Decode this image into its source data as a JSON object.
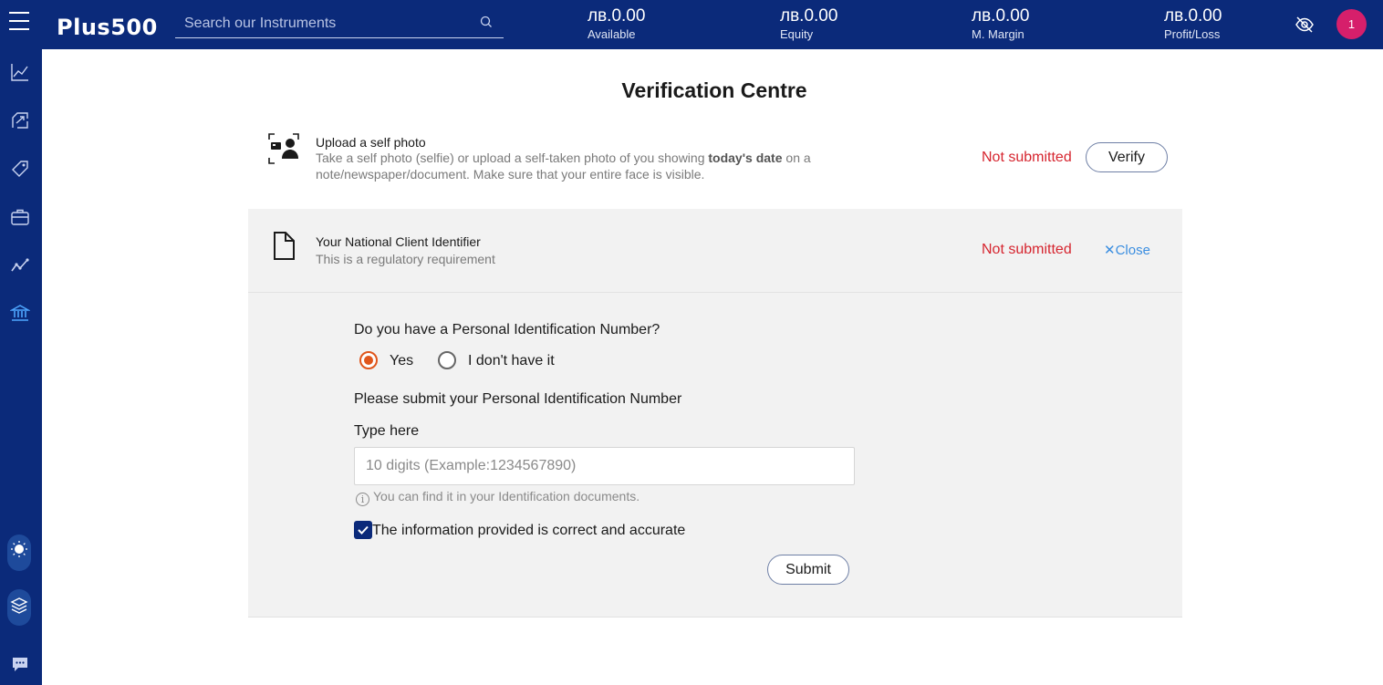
{
  "header": {
    "logo_text": "Plus500",
    "search": {
      "placeholder": "Search our Instruments"
    },
    "stats": [
      {
        "value": "лв.0.00",
        "label": "Available"
      },
      {
        "value": "лв.0.00",
        "label": "Equity"
      },
      {
        "value": "лв.0.00",
        "label": "M. Margin"
      },
      {
        "value": "лв.0.00",
        "label": "Profit/Loss"
      }
    ],
    "notification_count": "1"
  },
  "sidebar": {
    "icons": [
      "chart-line-icon",
      "swap-trade-icon",
      "price-tag-icon",
      "briefcase-icon",
      "trend-analysis-icon",
      "bank-icon",
      "light-theme-icon",
      "layers-icon",
      "chat-icon"
    ]
  },
  "page": {
    "title": "Verification Centre",
    "selfie": {
      "title": "Upload a self photo",
      "desc_before": "Take a self photo (selfie) or upload a self-taken photo of you showing ",
      "desc_bold": "today's date",
      "desc_after": " on a note/newspaper/document. Make sure that your entire face is visible.",
      "status": "Not submitted",
      "button": "Verify"
    },
    "nci": {
      "title": "Your National Client Identifier",
      "desc": "This is a regulatory requirement",
      "status": "Not submitted",
      "close_label": "Close"
    },
    "form": {
      "question": "Do you have a Personal Identification Number?",
      "options": [
        "Yes",
        "I don't have it"
      ],
      "selected": "Yes",
      "submit_prompt": "Please submit your Personal Identification Number",
      "field_label": "Type here",
      "placeholder": "10 digits (Example:1234567890)",
      "value": "",
      "hint": "You can find it in your Identification documents.",
      "confirm_label": "The information provided is correct and accurate",
      "confirm_checked": true,
      "submit_button": "Submit"
    }
  },
  "colors": {
    "brand_navy": "#0b2a7a",
    "status_red": "#d6252f",
    "radio_orange": "#e0561c",
    "link_blue": "#3b8ee0",
    "badge_pink": "#d61f6b"
  }
}
